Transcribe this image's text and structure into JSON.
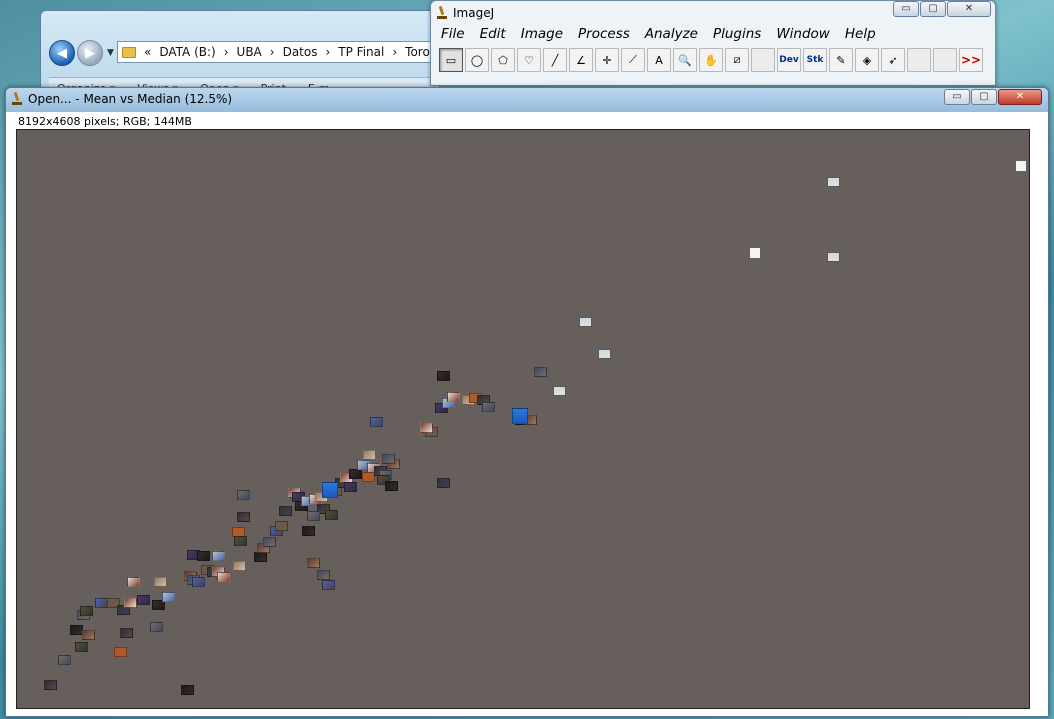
{
  "explorer": {
    "address": [
      "«",
      "DATA (B:)",
      "›",
      "UBA",
      "›",
      "Datos",
      "›",
      "TP Final",
      "›",
      "Toron"
    ],
    "toolbar": [
      "Organize ▾",
      "Views ▾",
      "Open ▾",
      "Print",
      "E-m"
    ]
  },
  "imagej": {
    "title": "ImageJ",
    "caption": {
      "minimize": "▭",
      "maximize": "▢",
      "close": "✕"
    },
    "menu": [
      "File",
      "Edit",
      "Image",
      "Process",
      "Analyze",
      "Plugins",
      "Window",
      "Help"
    ],
    "tools": [
      {
        "name": "rectangle-tool",
        "glyph": "▭",
        "selected": true
      },
      {
        "name": "oval-tool",
        "glyph": "◯"
      },
      {
        "name": "polygon-tool",
        "glyph": "⬠"
      },
      {
        "name": "freehand-tool",
        "glyph": "♡"
      },
      {
        "name": "line-tool",
        "glyph": "╱"
      },
      {
        "name": "angle-tool",
        "glyph": "∠"
      },
      {
        "name": "point-tool",
        "glyph": "✛"
      },
      {
        "name": "wand-tool",
        "glyph": "⟋"
      },
      {
        "name": "text-tool",
        "glyph": "A"
      },
      {
        "name": "magnifier-tool",
        "glyph": "🔍"
      },
      {
        "name": "hand-tool",
        "glyph": "✋"
      },
      {
        "name": "color-picker-tool",
        "glyph": "⧄"
      },
      {
        "name": "blank-slot",
        "glyph": ""
      },
      {
        "name": "dev-tool",
        "glyph": "Dev",
        "text": true
      },
      {
        "name": "stk-tool",
        "glyph": "Stk",
        "text": true
      },
      {
        "name": "brush-tool",
        "glyph": "✎"
      },
      {
        "name": "flood-fill-tool",
        "glyph": "◈"
      },
      {
        "name": "arrow-tool",
        "glyph": "➶"
      },
      {
        "name": "blank-slot-2",
        "glyph": ""
      },
      {
        "name": "blank-slot-3",
        "glyph": ""
      },
      {
        "name": "more-tools-button",
        "glyph": ">>",
        "more": true
      }
    ]
  },
  "imageWindow": {
    "title": "Open... - Mean vs Median (12.5%)",
    "info": "8192x4608 pixels; RGB; 144MB",
    "caption": {
      "minimize": "▭",
      "maximize": "▢",
      "close": "✕"
    }
  },
  "canvas": {
    "background": "#675f5b",
    "thumbColors": [
      "#3a2a2a",
      "#5b4b3b",
      "#8a3a2a",
      "#2a2a4a",
      "#6a5a4a",
      "#9a7a5a",
      "#3a4a6a",
      "#c8c0b0",
      "#1a1a1a",
      "#4a3a5a",
      "#7a6a5a",
      "#2a3a2a",
      "#b05a2a",
      "#3a6ac0",
      "#e0e0d8",
      "#5a3a3a"
    ]
  }
}
